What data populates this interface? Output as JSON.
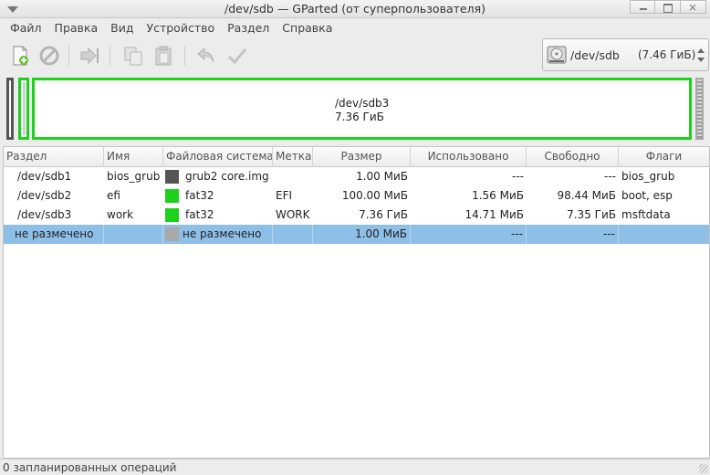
{
  "window": {
    "title": "/dev/sdb — GParted (от суперпользователя)",
    "close_glyph": "×"
  },
  "menu": [
    "Файл",
    "Правка",
    "Вид",
    "Устройство",
    "Раздел",
    "Справка"
  ],
  "toolbar_icons": [
    "new-partition-icon",
    "delete-icon",
    "resize-move-icon",
    "copy-icon",
    "paste-icon",
    "undo-icon",
    "apply-icon"
  ],
  "device": {
    "name": "/dev/sdb",
    "size": "(7.46 ГиБ)"
  },
  "visual_map": {
    "main_name": "/dev/sdb3",
    "main_size": "7.36 ГиБ"
  },
  "columns": [
    "Раздел",
    "Имя",
    "Файловая система",
    "Метка",
    "Размер",
    "Использовано",
    "Свободно",
    "Флаги"
  ],
  "rows": [
    {
      "partition": "/dev/sdb1",
      "name": "bios_grub",
      "fs": "grub2 core.img",
      "fs_color": "#555555",
      "label": "",
      "size": "1.00 МиБ",
      "used": "---",
      "free": "---",
      "flags": "bios_grub"
    },
    {
      "partition": "/dev/sdb2",
      "name": "efi",
      "fs": "fat32",
      "fs_color": "#1cd11c",
      "label": "EFI",
      "size": "100.00 МиБ",
      "used": "1.56 МиБ",
      "free": "98.44 МиБ",
      "flags": "boot, esp"
    },
    {
      "partition": "/dev/sdb3",
      "name": "work",
      "fs": "fat32",
      "fs_color": "#1cd11c",
      "label": "WORK",
      "size": "7.36 ГиБ",
      "used": "14.71 МиБ",
      "free": "7.35 ГиБ",
      "flags": "msftdata"
    },
    {
      "partition": "не размечено",
      "name": "",
      "fs": "не размечено",
      "fs_color": "#a9a9a9",
      "label": "",
      "size": "1.00 МиБ",
      "used": "---",
      "free": "---",
      "flags": ""
    }
  ],
  "selected_row": 3,
  "status": "0 запланированных операций",
  "colors": {
    "selection": "#8ec0e7",
    "fat32": "#1cd11c",
    "grub": "#555555",
    "unallocated": "#a9a9a9"
  }
}
